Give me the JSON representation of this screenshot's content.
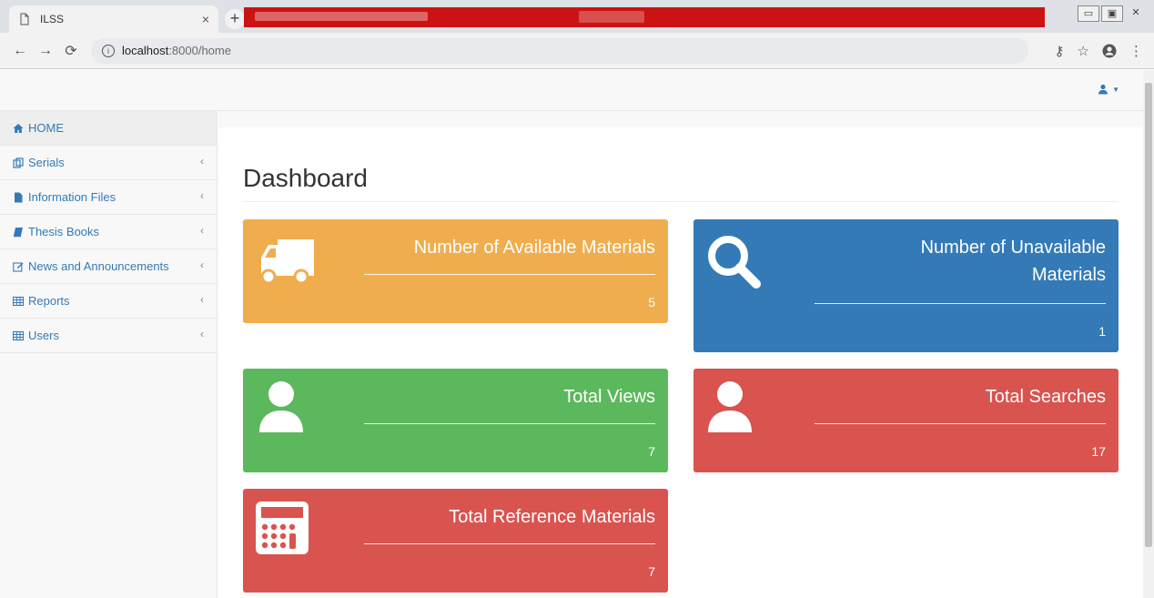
{
  "browser": {
    "tab_title": "ILSS",
    "url_host": "localhost",
    "url_rest": ":8000/home"
  },
  "sidebar": {
    "items": [
      {
        "label": "HOME",
        "icon": "home-icon"
      },
      {
        "label": "Serials",
        "icon": "copy-icon"
      },
      {
        "label": "Information Files",
        "icon": "file-icon"
      },
      {
        "label": "Thesis Books",
        "icon": "book-icon"
      },
      {
        "label": "News and Announcements",
        "icon": "edit-icon"
      },
      {
        "label": "Reports",
        "icon": "table-icon"
      },
      {
        "label": "Users",
        "icon": "table-icon"
      }
    ]
  },
  "main": {
    "title": "Dashboard",
    "panels": [
      {
        "label_line1": "Number of Available Materials",
        "count": "5",
        "color": "#f0ad4e",
        "icon": "truck-icon"
      },
      {
        "label_line1": "Number of Unavailable",
        "label_line2": "Materials",
        "count": "1",
        "color": "#337ab7",
        "icon": "search-icon"
      },
      {
        "label_line1": "Total Views",
        "count": "7",
        "color": "#5cb85c",
        "icon": "user-icon"
      },
      {
        "label_line1": "Total Searches",
        "count": "17",
        "color": "#d9534f",
        "icon": "user-icon"
      },
      {
        "label_line1": "Total Reference Materials",
        "count": "7",
        "color": "#d9534f",
        "icon": "calculator-icon"
      }
    ]
  }
}
